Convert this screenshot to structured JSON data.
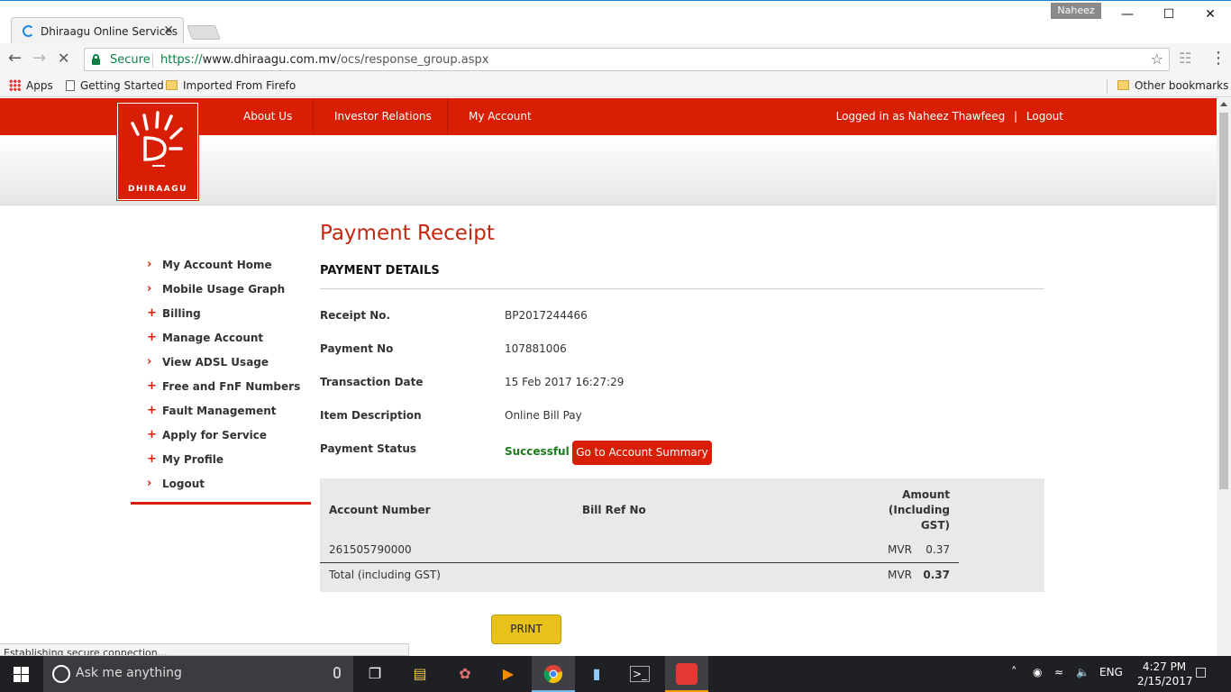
{
  "browser": {
    "tab_title": "Dhiraagu Online Services",
    "tab_close": "✕",
    "profile_name": "Naheez",
    "secure_label": "Secure",
    "url_scheme": "https://",
    "url_host": "www.dhiraagu.com.mv",
    "url_path": "/ocs/response_group.aspx",
    "bookmarks": [
      "Apps",
      "Getting Started",
      "Imported From Firefo",
      "Other bookmarks"
    ],
    "status_text": "Establishing secure connection..."
  },
  "site": {
    "logo_text": "DHIRAAGU",
    "nav": [
      "About Us",
      "Investor Relations",
      "My Account"
    ],
    "logged_in_text": "Logged in as Naheez Thawfeeg",
    "logged_in_sep": "|",
    "logout_label": "Logout",
    "sidebar": [
      {
        "label": "My Account Home",
        "marker": "›"
      },
      {
        "label": "Mobile Usage Graph",
        "marker": "›"
      },
      {
        "label": "Billing",
        "marker": "+"
      },
      {
        "label": "Manage Account",
        "marker": "+"
      },
      {
        "label": "View ADSL Usage",
        "marker": "›"
      },
      {
        "label": "Free and FnF Numbers",
        "marker": "+"
      },
      {
        "label": "Fault Management",
        "marker": "+"
      },
      {
        "label": "Apply for Service",
        "marker": "+"
      },
      {
        "label": "My Profile",
        "marker": "+"
      },
      {
        "label": "Logout",
        "marker": "›"
      }
    ],
    "page_title": "Payment Receipt",
    "section_title": "PAYMENT DETAILS",
    "details": [
      {
        "label": "Receipt No.",
        "value": "BP2017244466"
      },
      {
        "label": "Payment No",
        "value": "107881006"
      },
      {
        "label": "Transaction Date",
        "value": "15 Feb 2017 16:27:29"
      },
      {
        "label": "Item Description",
        "value": "Online Bill Pay"
      },
      {
        "label": "Payment Status",
        "value": "Successful"
      }
    ],
    "summary_button": "Go to Account Summary",
    "table": {
      "headers": [
        "Account Number",
        "Bill Ref No",
        "Amount",
        "(Including",
        "GST)"
      ],
      "rows": [
        {
          "account": "261505790000",
          "bill_ref": "",
          "currency": "MVR",
          "amount": "0.37"
        }
      ],
      "total_label": "Total (including GST)",
      "total_currency": "MVR",
      "total_amount": "0.37"
    },
    "print_button": "PRINT"
  },
  "taskbar": {
    "search_placeholder": "Ask me anything",
    "language": "ENG",
    "time": "4:27 PM",
    "date": "2/15/2017"
  },
  "colors": {
    "brand_red": "#d81e05",
    "title_red": "#c4280f",
    "success_green": "#1a7b1a",
    "print_yellow": "#e8c21a"
  }
}
